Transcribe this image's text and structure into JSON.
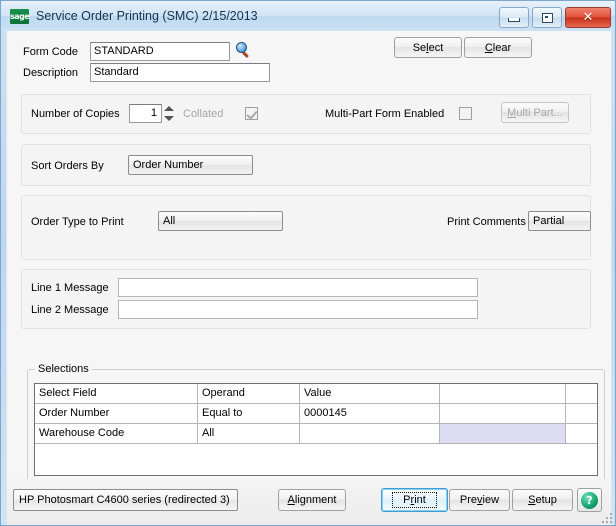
{
  "window": {
    "title": "Service Order Printing (SMC) 2/15/2013",
    "logo_text": "sage",
    "minimize_label": "–",
    "maximize_label": "□",
    "close_label": "✕"
  },
  "form": {
    "form_code_label": "Form Code",
    "form_code_value": "STANDARD",
    "description_label": "Description",
    "description_value": "Standard",
    "select_button": "Select",
    "clear_button": "Clear"
  },
  "copies": {
    "copies_label": "Number of Copies",
    "copies_value": "1",
    "collated_label": "Collated",
    "multipart_label": "Multi-Part Form Enabled",
    "multipart_button": "Multi Part..."
  },
  "sort": {
    "label": "Sort Orders By",
    "value": "Order Number"
  },
  "order_type": {
    "label": "Order Type to Print",
    "value": "All",
    "comments_label": "Print Comments",
    "comments_value": "Partial"
  },
  "messages": {
    "line1_label": "Line 1 Message",
    "line1_value": "",
    "line2_label": "Line 2 Message",
    "line2_value": ""
  },
  "selections": {
    "legend": "Selections",
    "columns": [
      "Select Field",
      "Operand",
      "Value",
      "",
      ""
    ],
    "rows": [
      {
        "field": "Order Number",
        "operand": "Equal to",
        "value": "0000145",
        "value2": ""
      },
      {
        "field": "Warehouse Code",
        "operand": "All",
        "value": "",
        "value2": ""
      }
    ]
  },
  "footer": {
    "printer": "HP Photosmart C4600 series (redirected 3)",
    "alignment_button": "Alignment",
    "print_button": "Print",
    "preview_button": "Preview",
    "setup_button": "Setup",
    "help_button": "?"
  },
  "colors": {
    "titlebar": "#cfe3f6",
    "client_bg": "#f6f6f6",
    "accent_focus": "#3c9fd8",
    "highlight_cell": "#dcdcf5",
    "close_red": "#c92f18",
    "sage_green": "#108043"
  }
}
